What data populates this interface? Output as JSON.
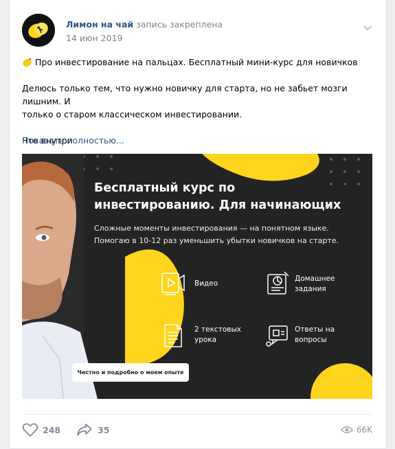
{
  "post": {
    "author": "Лимон на чай",
    "pinned_label": "запись закреплена",
    "date": "14 июн 2019",
    "lines": [
      "Про инвестирование на пальцах. Бесплатный мини-курс для новичков",
      "Делюсь только тем, что нужно новичку для старта, но не забьет мозги лишним. И",
      "только о старом классическом инвестировании.",
      "Что внутри"
    ],
    "show_more": "Показать полностью..."
  },
  "banner": {
    "title_line1": "Бесплатный курс по",
    "title_line2": "инвестированию. Для начинающих",
    "subtitle_line1": "Сложные моменты инвестирования — на понятном языке.",
    "subtitle_line2": "Помогаю в 10-12 раз уменьшить убытки новичков на старте.",
    "features": [
      {
        "line1": "Видео",
        "line2": "",
        "icon": "video-icon"
      },
      {
        "line1": "Домашнее",
        "line2": "задания",
        "icon": "homework-icon"
      },
      {
        "line1": "2 текстовых",
        "line2": "урока",
        "icon": "document-icon"
      },
      {
        "line1": "Ответы на",
        "line2": "вопросы",
        "icon": "qa-icon"
      }
    ],
    "pill": "Честно и подробно о моем опыте"
  },
  "footer": {
    "likes": "248",
    "shares": "35",
    "views": "66K"
  },
  "colors": {
    "link": "#2a5885",
    "accent_yellow": "#fed41d",
    "banner_bg": "#232323",
    "meta": "#828282"
  }
}
